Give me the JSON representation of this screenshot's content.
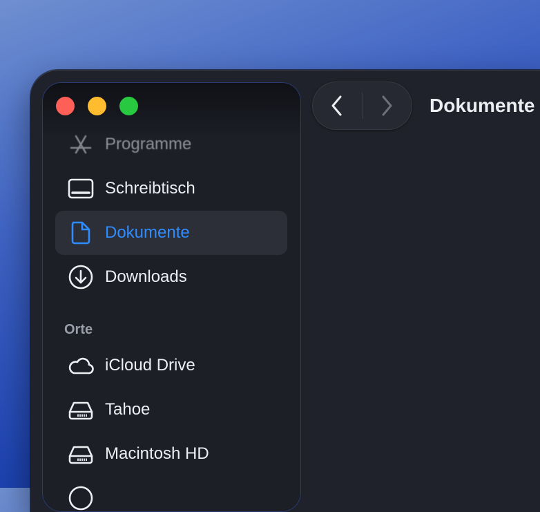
{
  "window": {
    "title": "Dokumente"
  },
  "sidebar": {
    "favorites": [
      {
        "label": "Programme",
        "icon": "apps-icon"
      },
      {
        "label": "Schreibtisch",
        "icon": "desktop-icon"
      },
      {
        "label": "Dokumente",
        "icon": "document-icon",
        "selected": true
      },
      {
        "label": "Downloads",
        "icon": "download-icon"
      }
    ],
    "locations_header": "Orte",
    "locations": [
      {
        "label": "iCloud Drive",
        "icon": "cloud-icon"
      },
      {
        "label": "Tahoe",
        "icon": "drive-icon"
      },
      {
        "label": "Macintosh HD",
        "icon": "drive-icon"
      }
    ]
  },
  "colors": {
    "accent": "#2f8cff",
    "close": "#fe5f57",
    "minimize": "#febc2e",
    "zoom": "#28c840"
  }
}
